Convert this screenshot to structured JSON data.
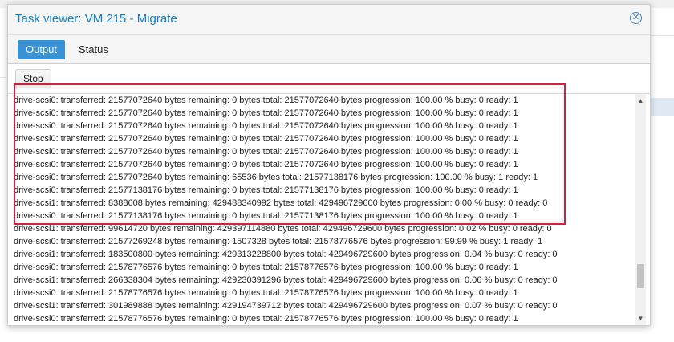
{
  "window": {
    "title": "Task viewer: VM 215 - Migrate",
    "close_icon": "close-icon"
  },
  "tabs": [
    {
      "label": "Output",
      "active": true
    },
    {
      "label": "Status",
      "active": false
    }
  ],
  "toolbar": {
    "stop_label": "Stop"
  },
  "log_lines": [
    "drive-scsi0: transferred: 21577072640 bytes remaining: 0 bytes total: 21577072640 bytes progression: 100.00 % busy: 0 ready: 1",
    "drive-scsi0: transferred: 21577072640 bytes remaining: 0 bytes total: 21577072640 bytes progression: 100.00 % busy: 0 ready: 1",
    "drive-scsi0: transferred: 21577072640 bytes remaining: 0 bytes total: 21577072640 bytes progression: 100.00 % busy: 0 ready: 1",
    "drive-scsi0: transferred: 21577072640 bytes remaining: 0 bytes total: 21577072640 bytes progression: 100.00 % busy: 0 ready: 1",
    "drive-scsi0: transferred: 21577072640 bytes remaining: 0 bytes total: 21577072640 bytes progression: 100.00 % busy: 0 ready: 1",
    "drive-scsi0: transferred: 21577072640 bytes remaining: 0 bytes total: 21577072640 bytes progression: 100.00 % busy: 0 ready: 1",
    "drive-scsi0: transferred: 21577072640 bytes remaining: 65536 bytes total: 21577138176 bytes progression: 100.00 % busy: 1 ready: 1",
    "drive-scsi0: transferred: 21577138176 bytes remaining: 0 bytes total: 21577138176 bytes progression: 100.00 % busy: 0 ready: 1",
    "drive-scsi1: transferred: 8388608 bytes remaining: 429488340992 bytes total: 429496729600 bytes progression: 0.00 % busy: 0 ready: 0",
    "drive-scsi0: transferred: 21577138176 bytes remaining: 0 bytes total: 21577138176 bytes progression: 100.00 % busy: 0 ready: 1",
    "drive-scsi1: transferred: 99614720 bytes remaining: 429397114880 bytes total: 429496729600 bytes progression: 0.02 % busy: 0 ready: 0",
    "drive-scsi0: transferred: 21577269248 bytes remaining: 1507328 bytes total: 21578776576 bytes progression: 99.99 % busy: 1 ready: 1",
    "drive-scsi1: transferred: 183500800 bytes remaining: 429313228800 bytes total: 429496729600 bytes progression: 0.04 % busy: 0 ready: 0",
    "drive-scsi0: transferred: 21578776576 bytes remaining: 0 bytes total: 21578776576 bytes progression: 100.00 % busy: 0 ready: 1",
    "drive-scsi1: transferred: 266338304 bytes remaining: 429230391296 bytes total: 429496729600 bytes progression: 0.06 % busy: 0 ready: 0",
    "drive-scsi0: transferred: 21578776576 bytes remaining: 0 bytes total: 21578776576 bytes progression: 100.00 % busy: 0 ready: 1",
    "drive-scsi1: transferred: 301989888 bytes remaining: 429194739712 bytes total: 429496729600 bytes progression: 0.07 % busy: 0 ready: 0",
    "drive-scsi0: transferred: 21578776576 bytes remaining: 0 bytes total: 21578776576 bytes progression: 100.00 % busy: 0 ready: 1"
  ],
  "colors": {
    "accent": "#157fcc",
    "active_tab": "#3892d4",
    "highlight_box": "#d2203a"
  }
}
